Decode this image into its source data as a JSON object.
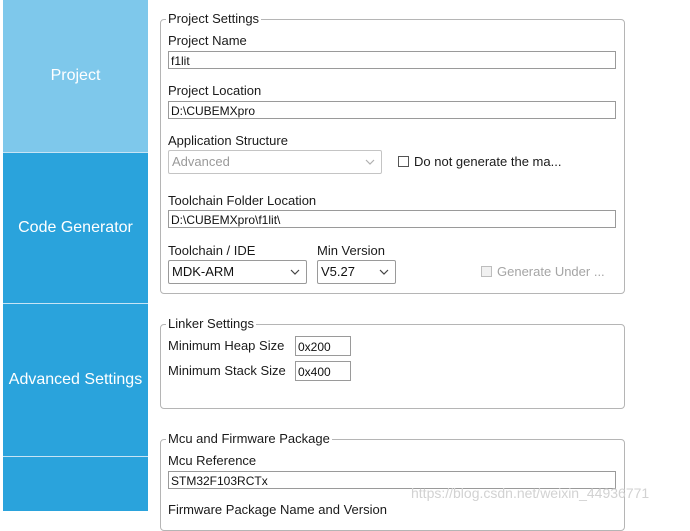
{
  "sidebar": {
    "items": [
      {
        "label": "Project",
        "state": "active"
      },
      {
        "label": "Code Generator",
        "state": "normal"
      },
      {
        "label": "Advanced Settings",
        "state": "normal"
      }
    ]
  },
  "project_settings": {
    "legend": "Project Settings",
    "project_name_label": "Project Name",
    "project_name_value": "f1lit",
    "project_location_label": "Project Location",
    "project_location_value": "D:\\CUBEMXpro",
    "app_structure_label": "Application Structure",
    "app_structure_value": "Advanced",
    "do_not_generate_label": "Do not generate the ma...",
    "toolchain_folder_label": "Toolchain Folder Location",
    "toolchain_folder_value": "D:\\CUBEMXpro\\f1lit\\",
    "toolchain_ide_label": "Toolchain / IDE",
    "toolchain_ide_value": "MDK-ARM",
    "min_version_label": "Min Version",
    "min_version_value": "V5.27",
    "generate_under_label": "Generate Under ..."
  },
  "linker_settings": {
    "legend": "Linker Settings",
    "heap_label": "Minimum Heap Size",
    "heap_value": "0x200",
    "stack_label": "Minimum Stack Size",
    "stack_value": "0x400"
  },
  "mcu_firmware": {
    "legend": "Mcu and Firmware Package",
    "mcu_reference_label": "Mcu Reference",
    "mcu_reference_value": "STM32F103RCTx",
    "firmware_package_label": "Firmware Package Name and Version"
  },
  "watermark": "https://blog.csdn.net/weixin_44936771",
  "colors": {
    "sidebar_active": "#7ec8eb",
    "sidebar_normal": "#2aa3dc",
    "border": "#b5b5b5"
  }
}
